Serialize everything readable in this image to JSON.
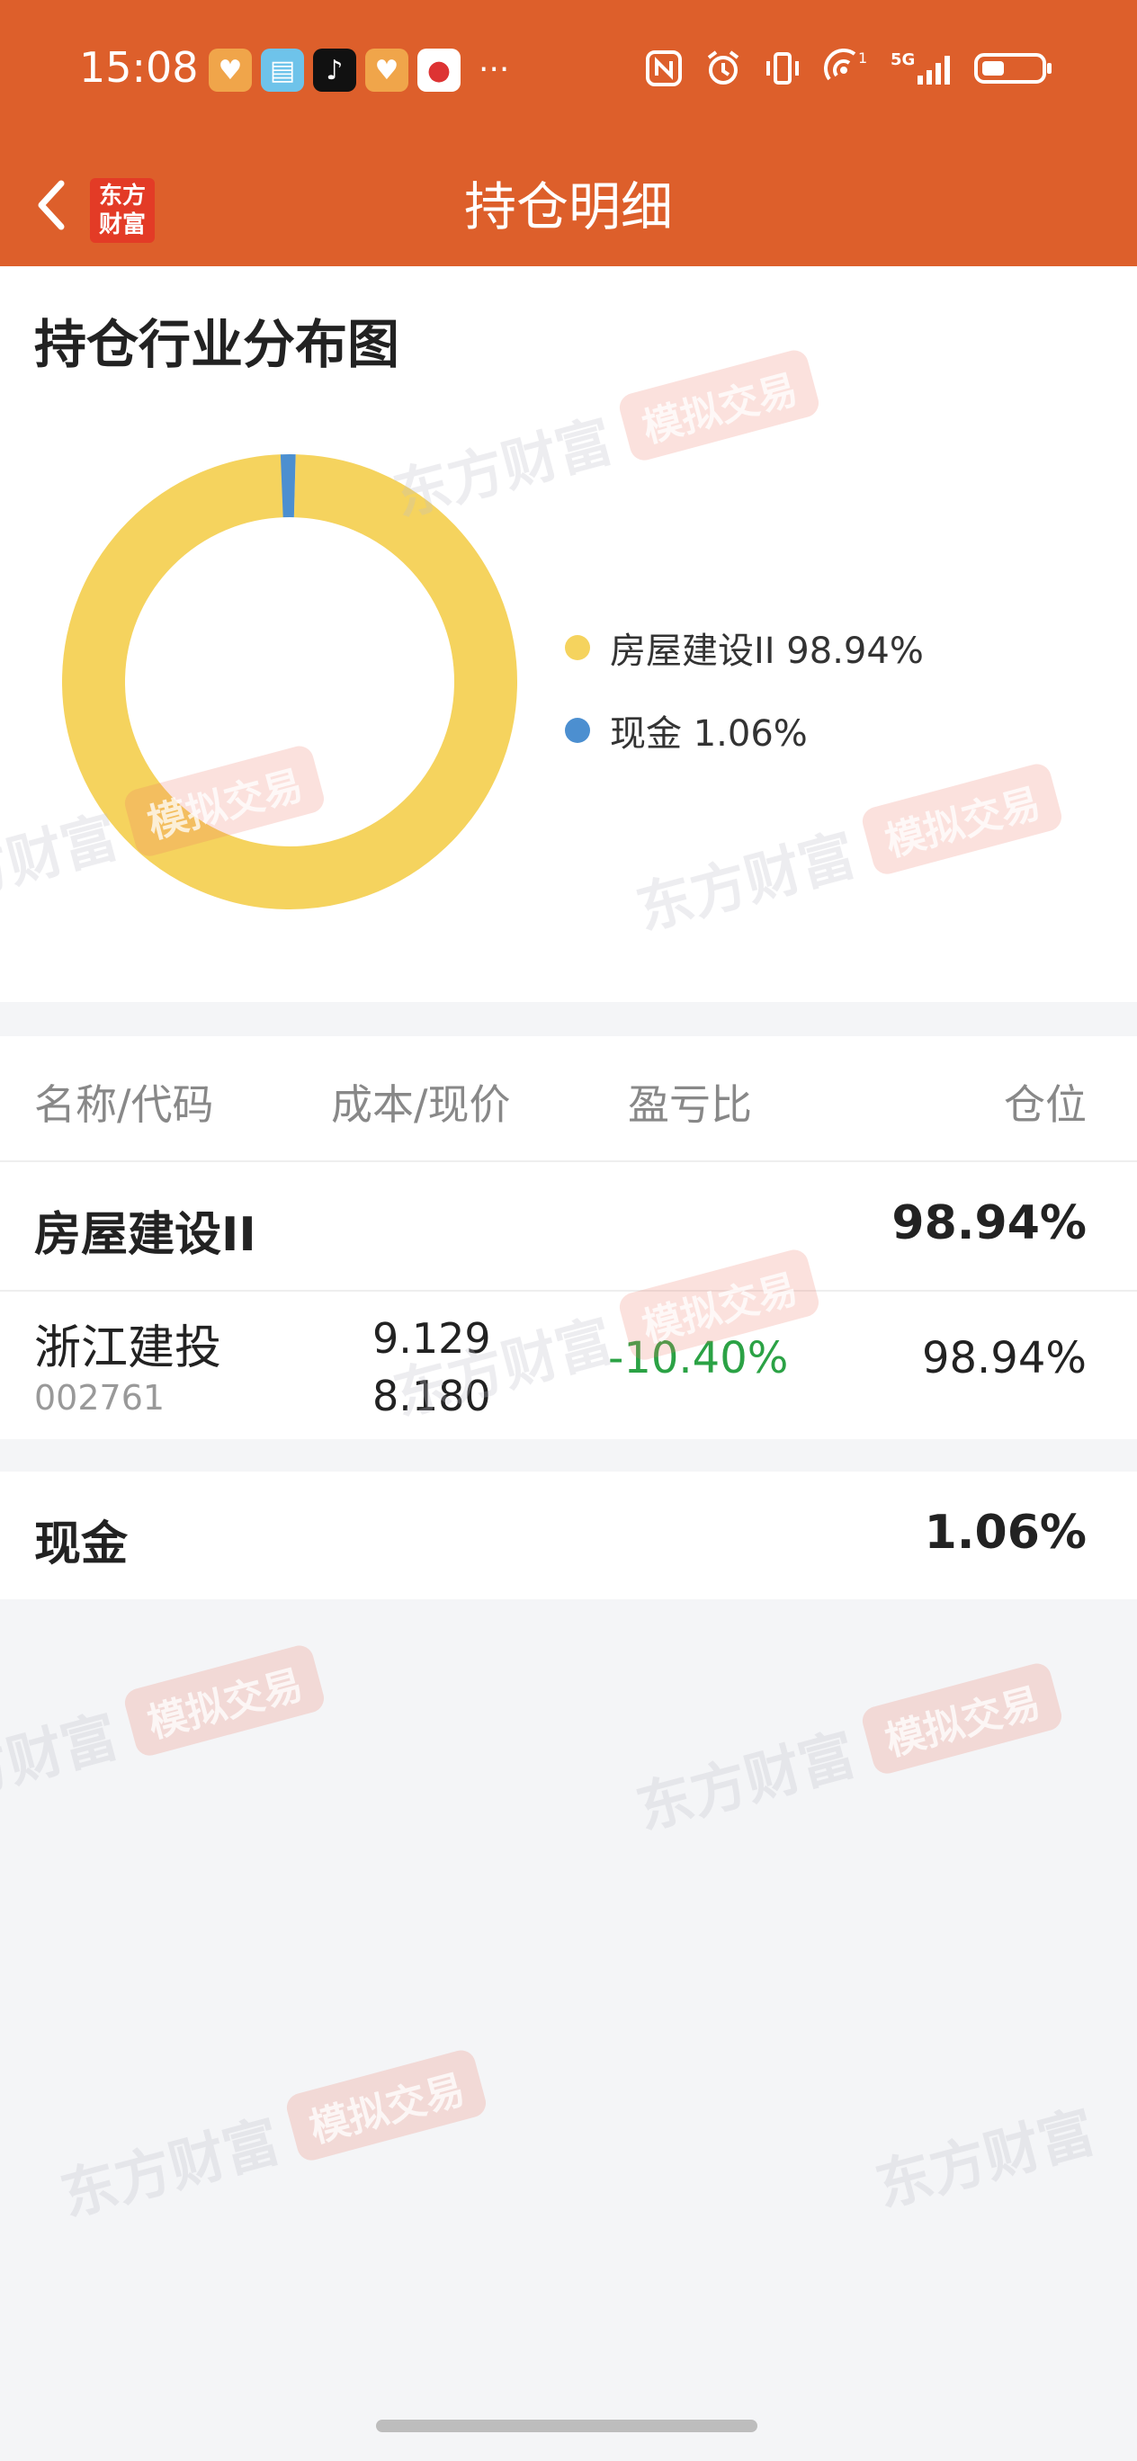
{
  "status_bar": {
    "time": "15:08",
    "more": "···"
  },
  "header": {
    "logo_text": "东方\n财富",
    "title": "持仓明细"
  },
  "chart_section": {
    "title": "持仓行业分布图",
    "legend": [
      {
        "label": "房屋建设II 98.94%",
        "color": "#f5d35e"
      },
      {
        "label": "现金 1.06%",
        "color": "#4c8fd0"
      }
    ]
  },
  "chart_data": {
    "type": "pie",
    "categories": [
      "房屋建设II",
      "现金"
    ],
    "values": [
      98.94,
      1.06
    ],
    "colors": [
      "#f5d35e",
      "#4c8fd0"
    ],
    "title": "持仓行业分布图",
    "style": "donut",
    "legend_position": "right"
  },
  "table": {
    "headers": {
      "name": "名称/代码",
      "cost": "成本/现价",
      "pl": "盈亏比",
      "position": "仓位"
    },
    "group1": {
      "name": "房屋建设II",
      "pct": "98.94%"
    },
    "stock": {
      "name": "浙江建投",
      "code": "002761",
      "cost": "9.129",
      "price": "8.180",
      "pl": "-10.40%",
      "position": "98.94%"
    },
    "group2": {
      "name": "现金",
      "pct": "1.06%"
    }
  },
  "watermark": {
    "brand": "东方财富",
    "tag": "模拟交易"
  },
  "colors": {
    "header_bg": "#dd5f2b",
    "loss_green": "#2ba245"
  }
}
